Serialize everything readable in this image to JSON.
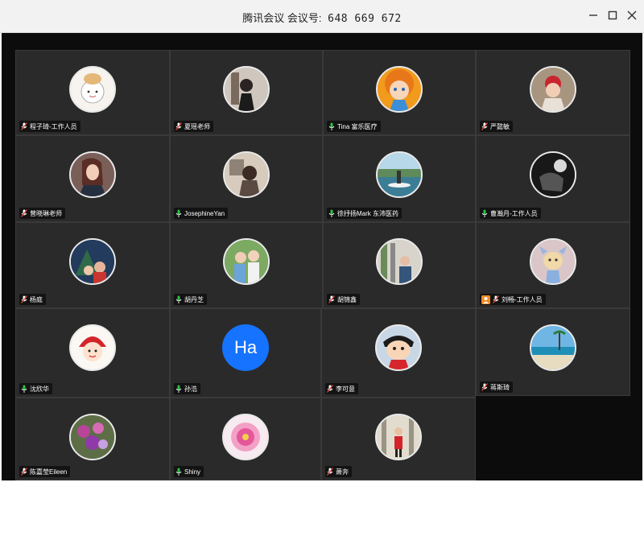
{
  "window": {
    "title": "腾讯会议 会议号:",
    "meeting_id": "648 669 672",
    "controls": [
      "minimize-icon",
      "maximize-icon",
      "close-icon"
    ]
  },
  "colors": {
    "tile_bg": "#2a2a2a",
    "mic_muted": "#e0443a",
    "mic_active": "#2fbf45",
    "avatar_blue": "#1673ff",
    "host_badge": "#f08a24"
  },
  "participants": [
    {
      "name": "程子琦-工作人员",
      "mic": "muted",
      "avatar": "cartoon-cat"
    },
    {
      "name": "夏瑶老师",
      "mic": "muted",
      "avatar": "photo"
    },
    {
      "name": "Tina 富乐医疗",
      "mic": "active",
      "avatar": "cartoon-girl"
    },
    {
      "name": "严懿敏",
      "mic": "muted",
      "avatar": "photo-child"
    },
    {
      "name": "曾晓琳老师",
      "mic": "muted",
      "avatar": "photo-woman"
    },
    {
      "name": "JosephineYan",
      "mic": "active",
      "avatar": "photo"
    },
    {
      "name": "徐抒扬Mark 东沛医药",
      "mic": "active",
      "avatar": "photo-paddleboard"
    },
    {
      "name": "曹瀚月-工作人员",
      "mic": "active",
      "avatar": "photo-dark"
    },
    {
      "name": "杨庭",
      "mic": "muted",
      "avatar": "photo-family"
    },
    {
      "name": "胡丹芝",
      "mic": "active",
      "avatar": "photo-kids"
    },
    {
      "name": "胡锦鑫",
      "mic": "muted",
      "avatar": "photo-street"
    },
    {
      "name": "刘畅-工作人员",
      "mic": "muted",
      "avatar": "cartoon-dog",
      "badge": "host"
    },
    {
      "name": "沈欣华",
      "mic": "active",
      "avatar": "cartoon-face"
    },
    {
      "name": "孙浩",
      "mic": "active",
      "avatar": "initials",
      "initials": "Ha"
    },
    {
      "name": "李可意",
      "mic": "muted",
      "avatar": "cartoon-boy"
    },
    {
      "name": "蒋斯琦",
      "mic": "muted",
      "avatar": "photo-beach"
    },
    {
      "name": "陈嘉莹Eileen",
      "mic": "muted",
      "avatar": "photo-flowers"
    },
    {
      "name": "Shiny",
      "mic": "active",
      "avatar": "photo-flower"
    },
    {
      "name": "萧奔",
      "mic": "muted",
      "avatar": "photo-person"
    }
  ]
}
